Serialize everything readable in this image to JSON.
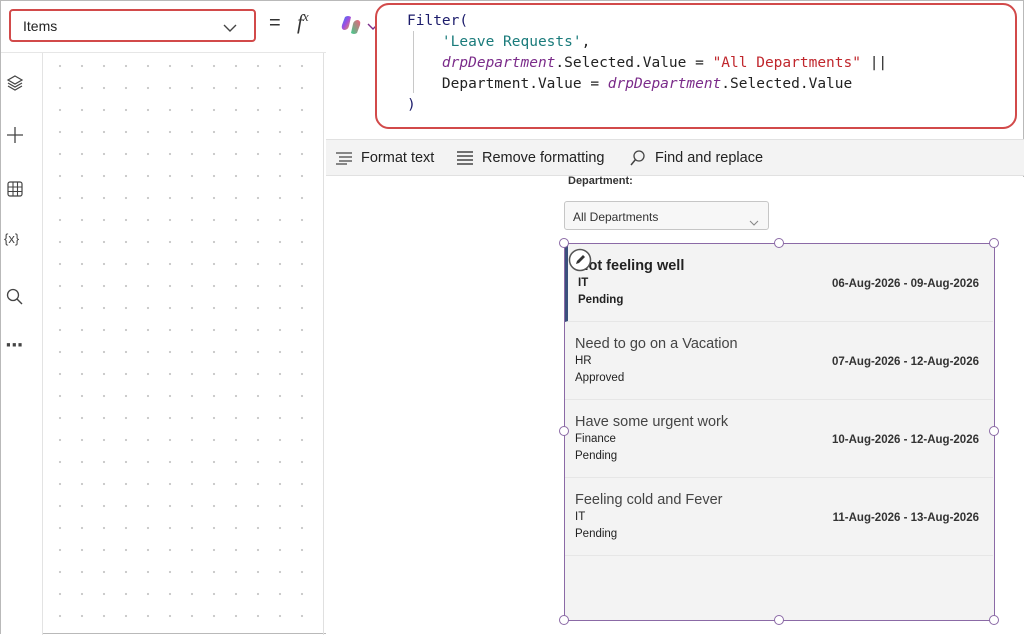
{
  "formula_bar": {
    "property": "Items",
    "equals": "=",
    "fx": "fx",
    "code_lines": {
      "l1_fn": "Filter(",
      "l2_str": "'Leave Requests'",
      "l2_tail": ",",
      "l3_var": "drpDepartment",
      "l3_mid": ".Selected.Value = ",
      "l3_str": "\"All Departments\"",
      "l3_op": " ||",
      "l4_head": "Department.Value = ",
      "l4_var": "drpDepartment",
      "l4_tail": ".Selected.Value",
      "l5_close": ")"
    }
  },
  "left_rail": {
    "icons": [
      "layers-icon",
      "plus-icon",
      "table-icon",
      "variable-icon",
      "search-icon",
      "more-icon"
    ],
    "variable_glyph": "{x}",
    "more_glyph": "···"
  },
  "toolbar": {
    "format_text": "Format text",
    "remove_formatting": "Remove formatting",
    "find_replace": "Find and replace"
  },
  "app": {
    "department_label": "Department:",
    "department_selected": "All Departments",
    "gallery": [
      {
        "title": "Not feeling well",
        "department": "IT",
        "status": "Pending",
        "dates": "06-Aug-2026 - 09-Aug-2026",
        "selected": true
      },
      {
        "title": "Need to go on a Vacation",
        "department": "HR",
        "status": "Approved",
        "dates": "07-Aug-2026 - 12-Aug-2026",
        "selected": false
      },
      {
        "title": "Have some urgent work",
        "department": "Finance",
        "status": "Pending",
        "dates": "10-Aug-2026 - 12-Aug-2026",
        "selected": false
      },
      {
        "title": "Feeling cold and Fever",
        "department": "IT",
        "status": "Pending",
        "dates": "11-Aug-2026 - 13-Aug-2026",
        "selected": false
      }
    ]
  },
  "colors": {
    "highlight_border": "#d24a4a",
    "selection_purple": "#8b6aa6",
    "selected_row_bar": "#3b4f7c"
  }
}
